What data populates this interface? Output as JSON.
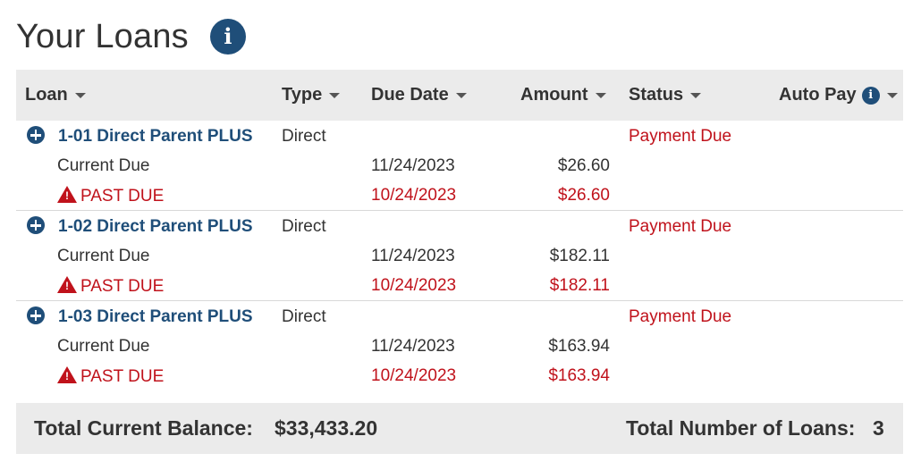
{
  "header": {
    "title": "Your Loans"
  },
  "columns": {
    "loan": "Loan",
    "type": "Type",
    "due_date": "Due Date",
    "amount": "Amount",
    "status": "Status",
    "autopay": "Auto Pay"
  },
  "loans": [
    {
      "name": "1-01 Direct Parent PLUS",
      "type": "Direct",
      "status": "Payment Due",
      "current_label": "Current Due",
      "current_date": "11/24/2023",
      "current_amount": "$26.60",
      "past_label": "PAST DUE",
      "past_date": "10/24/2023",
      "past_amount": "$26.60"
    },
    {
      "name": "1-02 Direct Parent PLUS",
      "type": "Direct",
      "status": "Payment Due",
      "current_label": "Current Due",
      "current_date": "11/24/2023",
      "current_amount": "$182.11",
      "past_label": "PAST DUE",
      "past_date": "10/24/2023",
      "past_amount": "$182.11"
    },
    {
      "name": "1-03 Direct Parent PLUS",
      "type": "Direct",
      "status": "Payment Due",
      "current_label": "Current Due",
      "current_date": "11/24/2023",
      "current_amount": "$163.94",
      "past_label": "PAST DUE",
      "past_date": "10/24/2023",
      "past_amount": "$163.94"
    }
  ],
  "footer": {
    "balance_label": "Total Current Balance:",
    "balance_value": "$33,433.20",
    "count_label": "Total Number of Loans:",
    "count_value": "3"
  },
  "colors": {
    "brand": "#1f4e79",
    "alert": "#c0121b",
    "header_bg": "#ebebeb"
  },
  "icons": {
    "info": "info-circle-icon",
    "expand": "plus-circle-icon",
    "warning": "warning-triangle-icon",
    "sort": "caret-down-icon"
  }
}
